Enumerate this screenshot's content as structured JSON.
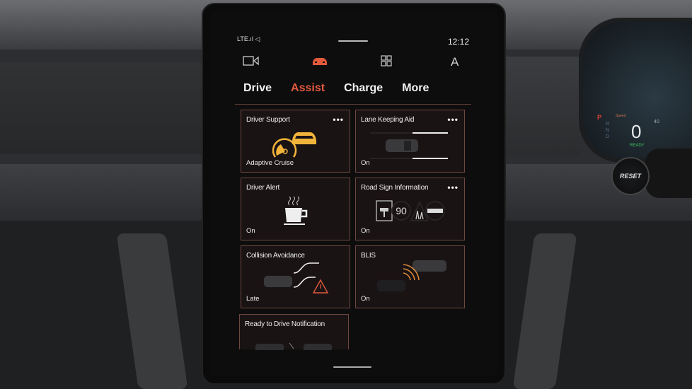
{
  "status_bar": {
    "network": "LTE.ıl ◁",
    "time": "12:12"
  },
  "top_icons": [
    {
      "name": "camera-icon",
      "glyph": "▭◁"
    },
    {
      "name": "car-icon",
      "glyph": "car"
    },
    {
      "name": "apps-grid-icon",
      "glyph": "▦"
    },
    {
      "name": "profile-icon",
      "glyph": "A"
    }
  ],
  "tabs": [
    {
      "label": "Drive"
    },
    {
      "label": "Assist",
      "active": true
    },
    {
      "label": "Charge"
    },
    {
      "label": "More"
    }
  ],
  "accent_color": "#e25a3c",
  "cards": [
    {
      "title": "Driver Support",
      "status": "Adaptive Cruise",
      "has_menu": true,
      "icon": "adaptive-cruise-icon"
    },
    {
      "title": "Lane Keeping Aid",
      "status": "On",
      "has_menu": true,
      "icon": "lane-keeping-icon"
    },
    {
      "title": "Driver Alert",
      "status": "On",
      "has_menu": false,
      "icon": "coffee-cup-icon"
    },
    {
      "title": "Road Sign Information",
      "status": "On",
      "has_menu": true,
      "icon": "road-sign-icon",
      "speed_sign": "90"
    },
    {
      "title": "Collision Avoidance",
      "status": "Late",
      "has_menu": false,
      "icon": "collision-warning-icon"
    },
    {
      "title": "BLIS",
      "status": "On",
      "has_menu": false,
      "icon": "blind-spot-icon"
    },
    {
      "title": "Ready to Drive Notification",
      "status": "",
      "has_menu": false,
      "icon": "ready-to-drive-icon"
    }
  ],
  "menu_label": "•••",
  "cluster": {
    "gear": "P",
    "gears": "R N D",
    "speed": "0",
    "ready": "READY",
    "limit": "40",
    "speed_label": "Speed"
  },
  "reset_button": "RESET"
}
